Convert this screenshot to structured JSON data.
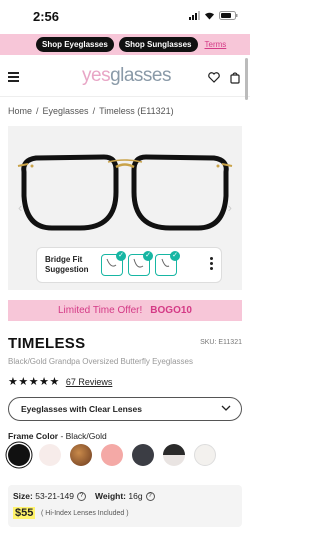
{
  "status": {
    "time": "2:56"
  },
  "promo": {
    "btn_eyeglasses": "Shop Eyeglasses",
    "btn_sunglasses": "Shop Sunglasses",
    "terms": "Terms"
  },
  "header": {
    "logo_yes": "yes",
    "logo_glasses": "glasses",
    "icons": [
      "menu-icon",
      "heart-icon",
      "bag-icon"
    ]
  },
  "breadcrumb": [
    "Home",
    "Eyeglasses",
    "Timeless (E11321)"
  ],
  "gallery": {
    "bridge_fit": "Bridge Fit Suggestion"
  },
  "offer": {
    "text": "Limited Time Offer!",
    "code": "BOGO10"
  },
  "product": {
    "title": "TIMELESS",
    "sku": "SKU: E11321",
    "subtitle": "Black/Gold Grandpa Oversized Butterfly Eyeglasses",
    "stars": "★★★★★",
    "reviews": "67 Reviews",
    "lens_option": "Eyeglasses with Clear Lenses",
    "frame_color_label": "Frame Color",
    "frame_color_value": " - Black/Gold",
    "swatch_colors": [
      "#111111",
      "#f7ecea",
      "#6b3a1f",
      "#f4a9a6",
      "#3b3d44",
      "#d9d2cf",
      "#f3f1ee"
    ],
    "size_label": "Size:",
    "size_value": "53-21-149",
    "weight_label": "Weight:",
    "weight_value": "16g",
    "price": "$55",
    "price_note": "( Hi-Index Lenses Included )"
  },
  "colors": {
    "accent_pink": "#f7c6d8",
    "pink_text": "#d43a86",
    "teal": "#17b6a3",
    "highlight": "#fff36b"
  }
}
